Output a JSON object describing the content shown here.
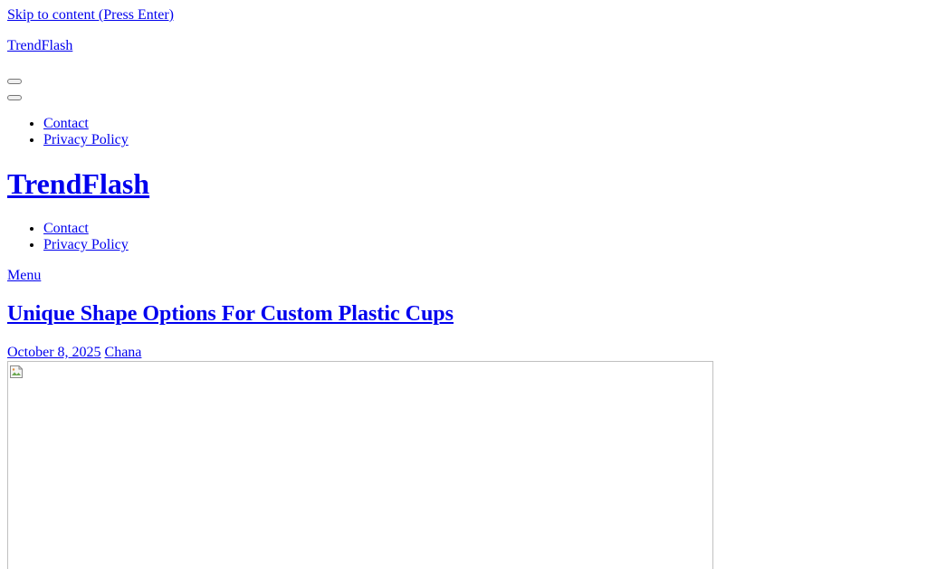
{
  "skip_link": "Skip to content (Press Enter)",
  "top_brand": "TrendFlash",
  "nav_primary": {
    "items": [
      {
        "label": "Contact"
      },
      {
        "label": "Privacy Policy"
      }
    ]
  },
  "site_title": "TrendFlash",
  "nav_secondary": {
    "items": [
      {
        "label": "Contact"
      },
      {
        "label": "Privacy Policy"
      }
    ]
  },
  "menu_link": "Menu",
  "post": {
    "title": "Unique Shape Options For Custom Plastic Cups",
    "date": "October 8, 2025",
    "author": "Chana"
  },
  "colors": {
    "link": "#0000ee",
    "background": "#ffffff"
  }
}
